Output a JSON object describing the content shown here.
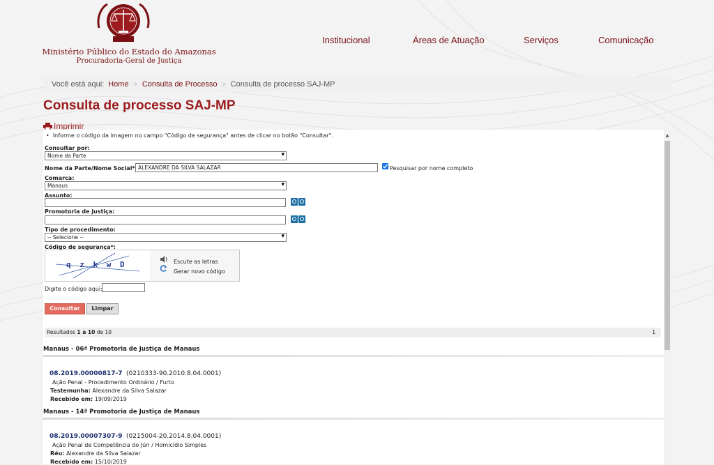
{
  "header": {
    "org_name": "Ministério Público do Estado do Amazonas",
    "org_sub": "Procuradoria-Geral de Justiça",
    "nav": [
      "Institucional",
      "Áreas de Atuação",
      "Serviços",
      "Comunicação"
    ]
  },
  "breadcrumb": {
    "prefix": "Você está aqui:",
    "home": "Home",
    "parent": "Consulta de Processo",
    "current": "Consulta de processo SAJ-MP"
  },
  "page_title": "Consulta de processo SAJ-MP",
  "print_label": "Imprimir",
  "form": {
    "hint": "Informe o código da imagem no campo \"Código de segurança\" antes de clicar no botão \"Consultar\".",
    "consultar_por_label": "Consultar por:",
    "consultar_por_value": "Nome da Parte",
    "nome_label": "Nome da Parte/Nome Social*:",
    "nome_value": "ALEXANDRE DA SILVA SALAZAR",
    "nome_completo_label": "Pesquisar por nome completo",
    "comarca_label": "Comarca:",
    "comarca_value": "Manaus",
    "assunto_label": "Assunto:",
    "promotoria_label": "Promotoria de justiça:",
    "tipo_label": "Tipo de procedimento:",
    "tipo_value": "-- Selecione --",
    "seguranca_label": "Código de segurança*:",
    "captcha_text": "q z k w D",
    "escute_label": "Escute as letras",
    "gerar_label": "Gerar novo código",
    "digite_label": "Digite o código aqui:",
    "consultar_btn": "Consultar",
    "limpar_btn": "Limpar"
  },
  "results": {
    "prefix": "Resultados ",
    "range": "1 a 10",
    "mid": " de ",
    "total": "10",
    "page": "1",
    "groups": [
      {
        "title": "Manaus - 06ª Promotoria de Justiça de Manaus",
        "number": "08.2019.00000817-7",
        "alt_number": "(0210333-90.2010.8.04.0001)",
        "class": "Ação Penal - Procedimento Ordinário / Furto",
        "role_label": "Testemunha:",
        "role_value": "Alexandre da Silva Salazar",
        "received_label": "Recebido em:",
        "received_value": "19/09/2019"
      },
      {
        "title": "Manaus - 14ª Promotoria de Justiça de Manaus",
        "number": "08.2019.00007307-9",
        "alt_number": "(0215004-20.2014.8.04.0001)",
        "class": "Ação Penal de Competência do Júri / Homicídio Simples",
        "role_label": "Réu:",
        "role_value": "Alexandre da Silva Salazar",
        "received_label": "Recebido em:",
        "received_value": "15/10/2019"
      }
    ]
  },
  "colors": {
    "brand": "#9b1b1e",
    "link_dark": "#1c2e6b",
    "button": "#e26a5e"
  }
}
